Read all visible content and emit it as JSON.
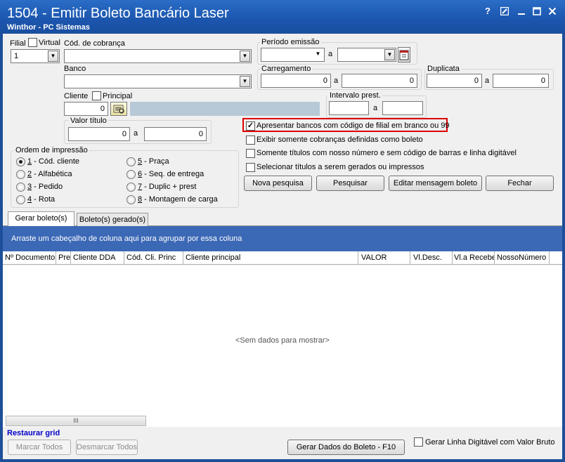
{
  "window": {
    "title": "1504 - Emitir Boleto Bancário Laser",
    "subtitle": "Winthor - PC Sistemas",
    "help": "?",
    "controls": [
      "edit",
      "minimize",
      "maximize",
      "close"
    ]
  },
  "filters": {
    "filial_label": "Filial",
    "virtual_label": "Virtual",
    "filial_value": "1",
    "cod_cobranca_label": "Cód. de cobrança",
    "cod_cobranca_value": "",
    "banco_label": "Banco",
    "banco_value": "",
    "cliente_label": "Cliente",
    "principal_label": "Principal",
    "cliente_value": "0",
    "cliente_name": "",
    "valor_titulo_label": "Valor título",
    "valor_de": "0",
    "valor_a_label": "a",
    "valor_ate": "0",
    "periodo_emissao_label": "Período emissão",
    "periodo_de": "",
    "periodo_a_label": "a",
    "periodo_ate": "",
    "carregamento_label": "Carregamento",
    "carregamento_de": "0",
    "carregamento_a_label": "a",
    "carregamento_ate": "0",
    "duplicata_label": "Duplicata",
    "duplicata_de": "0",
    "duplicata_a_label": "a",
    "duplicata_ate": "0",
    "intervalo_label": "Intervalo prest.",
    "intervalo_de": "",
    "intervalo_a_label": "a",
    "intervalo_ate": ""
  },
  "ordem": {
    "title": "Ordem de impressão",
    "options": [
      {
        "key": "1",
        "rest": " - Cód. cliente",
        "selected": true
      },
      {
        "key": "2",
        "rest": " - Alfabética",
        "selected": false
      },
      {
        "key": "3",
        "rest": " - Pedido",
        "selected": false
      },
      {
        "key": "4",
        "rest": " - Rota",
        "selected": false
      },
      {
        "key": "5",
        "rest": " - Praça",
        "selected": false
      },
      {
        "key": "6",
        "rest": " - Seq. de entrega",
        "selected": false
      },
      {
        "key": "7",
        "rest": " - Duplic + prest",
        "selected": false
      },
      {
        "key": "8",
        "rest": " - Montagem de carga",
        "selected": false
      }
    ]
  },
  "options": {
    "apresentar_bancos": {
      "label": "Apresentar bancos com código de filial em branco ou 99",
      "checked": true
    },
    "exibir_cobrancas": {
      "label": "Exibir somente cobranças definidas como boleto",
      "checked": false
    },
    "somente_titulos": {
      "label": "Somente títulos com nosso número e sem código de barras e linha digitável",
      "checked": false
    },
    "selecionar_titulos": {
      "label": "Selecionar títulos a serem gerados ou impressos",
      "checked": false
    }
  },
  "actions": {
    "nova_pesquisa": "Nova pesquisa",
    "pesquisar": "Pesquisar",
    "editar_mensagem": "Editar mensagem boleto",
    "fechar": "Fechar"
  },
  "tabs": [
    "Gerar boleto(s)",
    "Boleto(s) gerado(s)"
  ],
  "grid": {
    "group_hint": "Arraste um cabeçalho de coluna aqui para agrupar por essa coluna",
    "columns": [
      "Nº Documento",
      "Pre",
      "Cliente DDA",
      "Cód. Cli. Princ",
      "Cliente principal",
      "VALOR",
      "Vl.Desc.",
      "Vl.a Receber",
      "NossoNúmero"
    ],
    "empty_text": "<Sem dados para mostrar>",
    "scroll_grip": "III"
  },
  "footer": {
    "restaurar": "Restaurar grid",
    "marcar": "Marcar Todos",
    "desmarcar": "Desmarcar Todos",
    "gerar": "Gerar Dados do Boleto - F10",
    "gerar_linha_label": "Gerar Linha Digitável com Valor Bruto",
    "gerar_linha_checked": false
  },
  "colors": {
    "titlebar": "#1b55ad",
    "grid_band": "#3c69b6",
    "highlight": "#e00000",
    "link_blue": "#0000c8"
  }
}
